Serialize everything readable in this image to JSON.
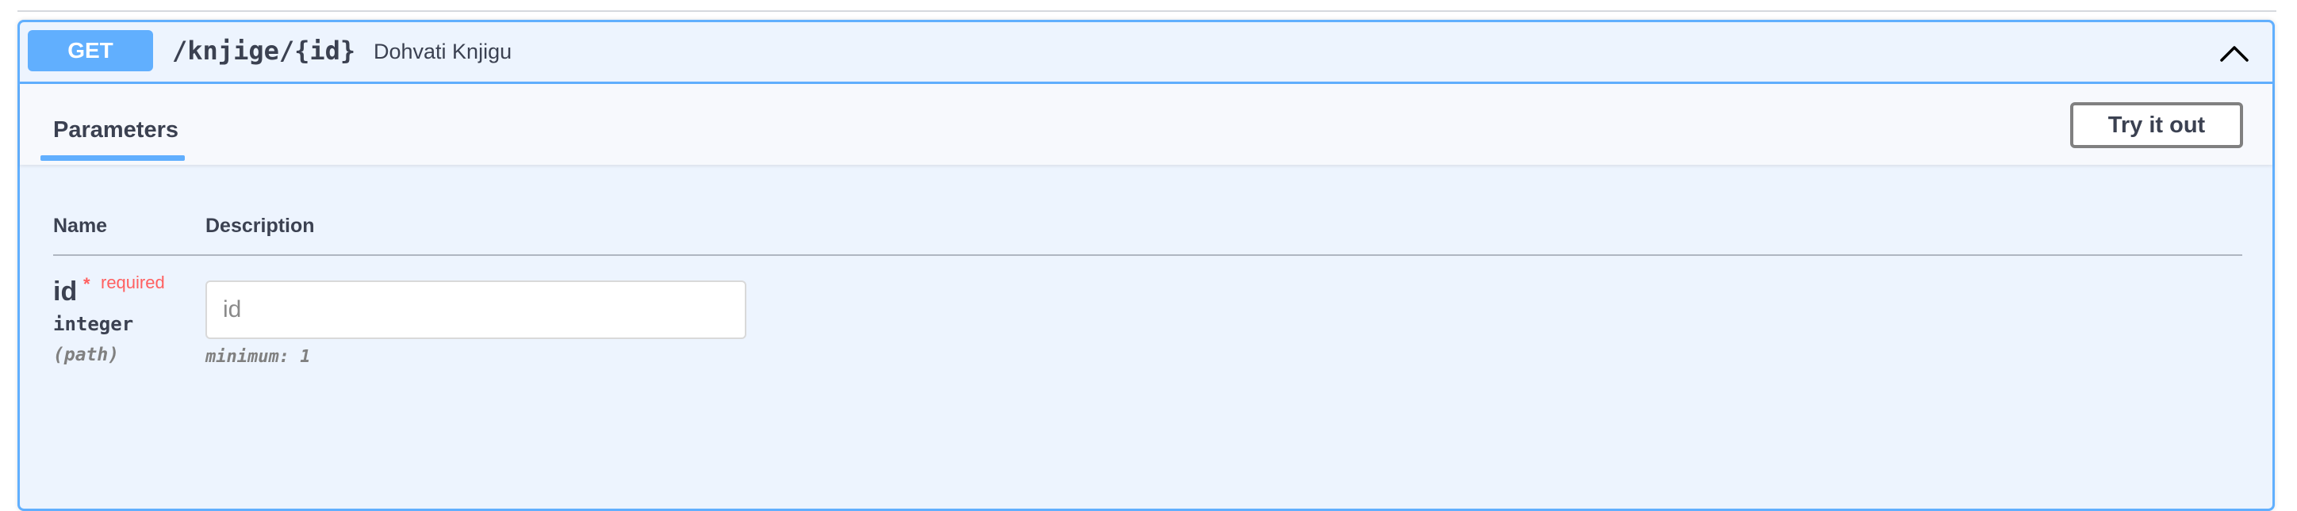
{
  "operation": {
    "method": "GET",
    "path": "/knjige/{id}",
    "summary": "Dohvati Knjigu",
    "collapse_icon": "chevron-up-icon"
  },
  "section": {
    "tab_label": "Parameters",
    "try_button_label": "Try it out"
  },
  "table": {
    "headers": [
      "Name",
      "Description"
    ]
  },
  "parameters": [
    {
      "name": "id",
      "required_mark": "*",
      "required_label": "required",
      "type": "integer",
      "in": "(path)",
      "placeholder": "id",
      "value": "",
      "constraint": "minimum: 1"
    }
  ],
  "colors": {
    "accent": "#61affe",
    "required": "#ff6060"
  }
}
